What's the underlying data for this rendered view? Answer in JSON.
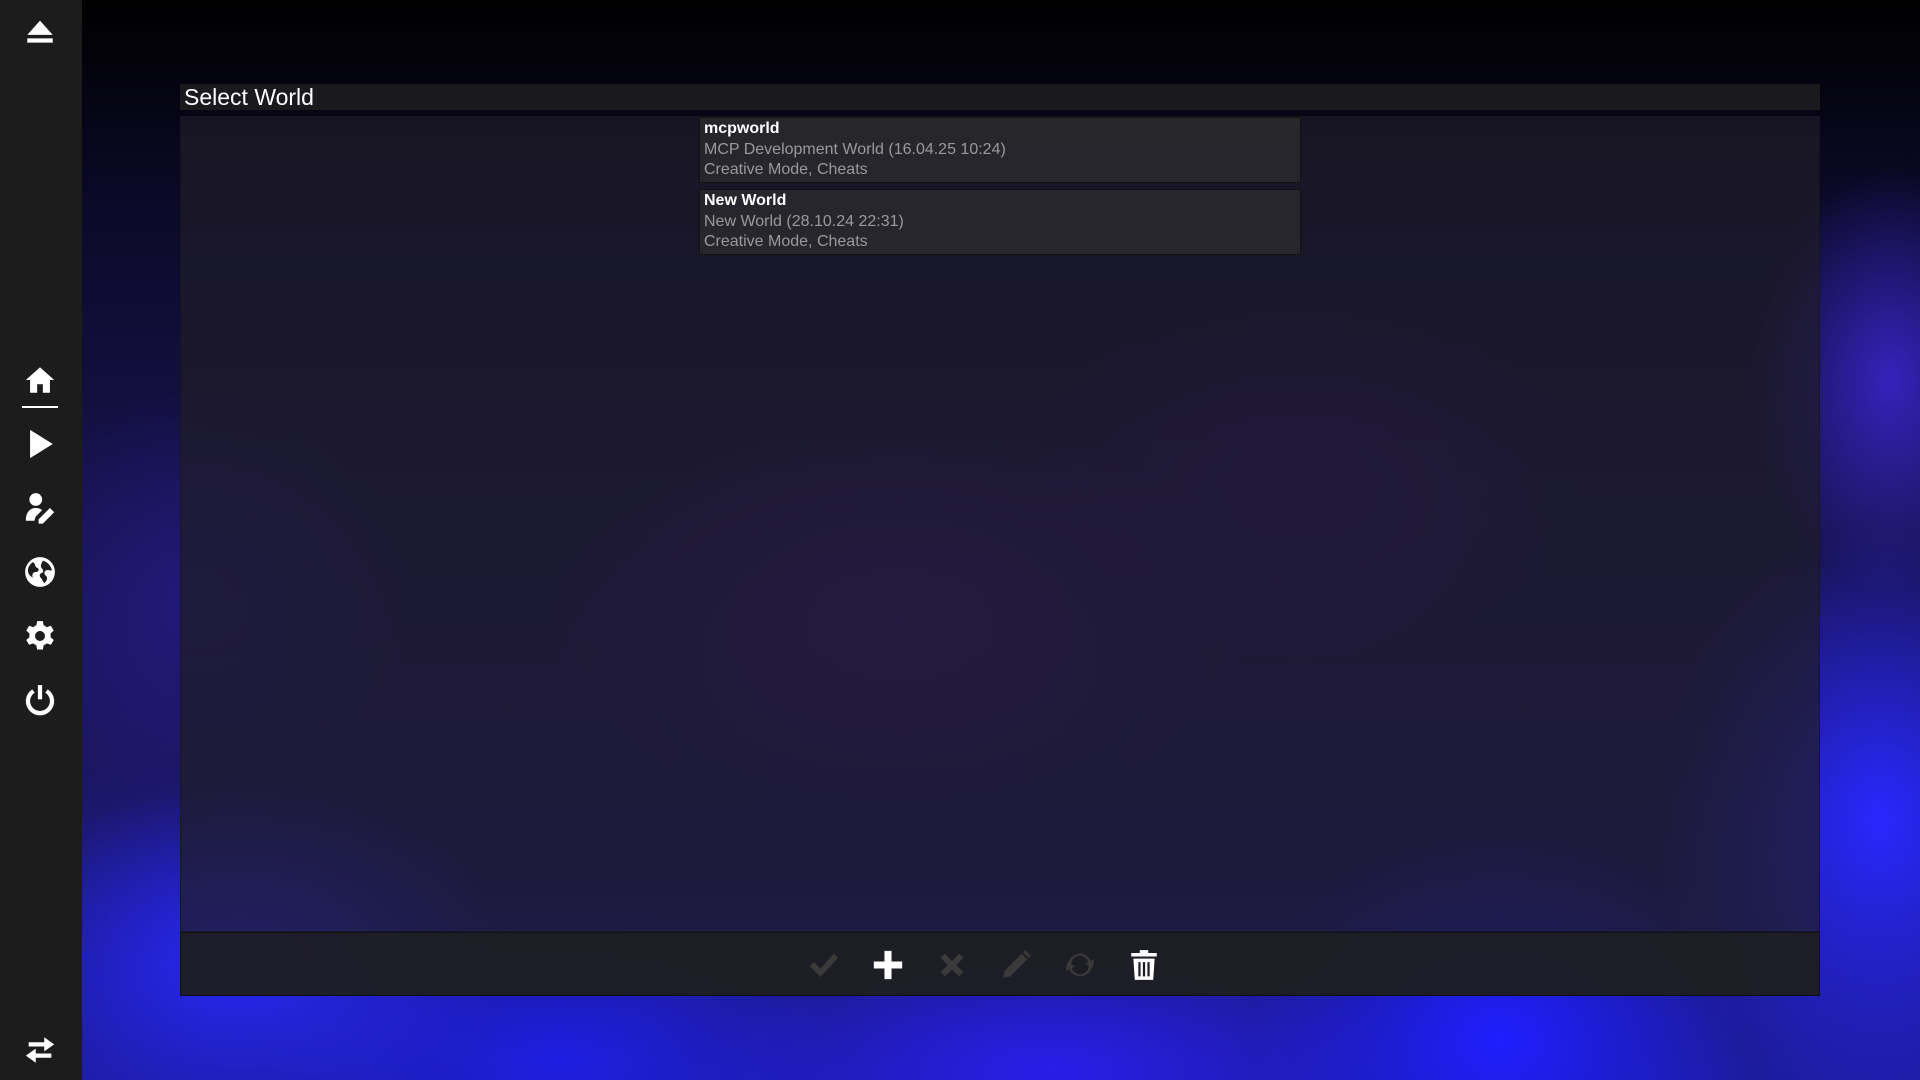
{
  "screen": {
    "title": "Select World"
  },
  "sidebar": {
    "items": [
      {
        "icon": "eject-icon"
      },
      {
        "icon": "home-icon",
        "active": true
      },
      {
        "icon": "play-icon"
      },
      {
        "icon": "edit-profile-icon"
      },
      {
        "icon": "globe-icon"
      },
      {
        "icon": "gear-icon"
      },
      {
        "icon": "power-icon"
      },
      {
        "icon": "swap-icon"
      }
    ]
  },
  "worlds": [
    {
      "name": "mcpworld",
      "description": "MCP Development World (16.04.25 10:24)",
      "mode": "Creative Mode, Cheats"
    },
    {
      "name": "New World",
      "description": "New World (28.10.24 22:31)",
      "mode": "Creative Mode, Cheats"
    }
  ],
  "toolbar": {
    "buttons": [
      {
        "icon": "check-icon",
        "enabled": false
      },
      {
        "icon": "plus-icon",
        "enabled": true
      },
      {
        "icon": "close-icon",
        "enabled": false
      },
      {
        "icon": "pencil-icon",
        "enabled": false
      },
      {
        "icon": "refresh-icon",
        "enabled": false
      },
      {
        "icon": "trash-icon",
        "enabled": true
      }
    ]
  },
  "colors": {
    "sidebar_bg": "#1c1c1c",
    "text_primary": "#ffffff",
    "text_secondary": "#9a9a9a",
    "disabled_icon": "#3a3a3a"
  }
}
